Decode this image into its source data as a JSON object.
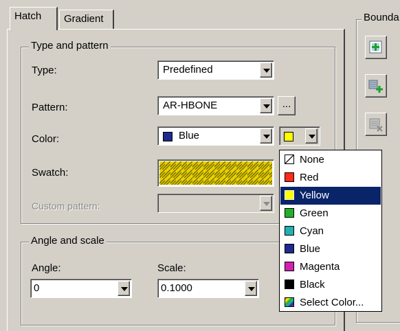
{
  "tabs": {
    "hatch": "Hatch",
    "gradient": "Gradient"
  },
  "type_and_pattern": {
    "title": "Type and pattern",
    "type_label": "Type:",
    "type_value": "Predefined",
    "pattern_label": "Pattern:",
    "pattern_value": "AR-HBONE",
    "pattern_browse": "...",
    "color_label": "Color:",
    "color_value": "Blue",
    "swatch_label": "Swatch:",
    "custom_pattern_label": "Custom pattern:"
  },
  "angle_and_scale": {
    "title": "Angle and scale",
    "angle_label": "Angle:",
    "angle_value": "0",
    "scale_label": "Scale:",
    "scale_value": "0.1000"
  },
  "boundaries": {
    "title": "Bounda"
  },
  "color_menu": {
    "items": [
      {
        "label": "None",
        "color": "#ffffff"
      },
      {
        "label": "Red",
        "color": "#ff2a1a"
      },
      {
        "label": "Yellow",
        "color": "#ffff00"
      },
      {
        "label": "Green",
        "color": "#22b02a"
      },
      {
        "label": "Cyan",
        "color": "#22b0b0"
      },
      {
        "label": "Blue",
        "color": "#1e2a8c"
      },
      {
        "label": "Magenta",
        "color": "#d023b0"
      },
      {
        "label": "Black",
        "color": "#000000"
      },
      {
        "label": "Select Color...",
        "color": "#8844cc"
      }
    ],
    "selected": "Yellow"
  },
  "colors": {
    "current_color": "#1e2a8c",
    "background_color": "#ffff00",
    "swatch_pattern": "#e6d200",
    "selection": "#0a246a"
  }
}
